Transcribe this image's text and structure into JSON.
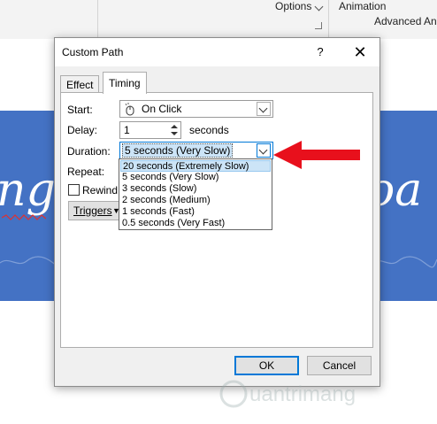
{
  "ribbon": {
    "options_label": "Options",
    "animation_label": "Animation",
    "advanced_label": "Advanced Anima"
  },
  "slide": {
    "left_script_text": "ng",
    "right_script_text": "oa"
  },
  "dialog": {
    "title": "Custom Path",
    "help_symbol": "?",
    "close_symbol": "✕",
    "tabs": [
      {
        "label": "Effect",
        "selected": false
      },
      {
        "label": "Timing",
        "selected": true
      }
    ],
    "start": {
      "label": "Start:",
      "value": "On Click"
    },
    "delay": {
      "label": "Delay:",
      "value": "1",
      "unit": "seconds"
    },
    "duration": {
      "label": "Duration:",
      "value": "5 seconds (Very Slow)"
    },
    "repeat": {
      "label": "Repeat:"
    },
    "rewind": {
      "label": "Rewind",
      "checked": false
    },
    "triggers": {
      "label": "Triggers"
    },
    "duration_options": [
      "20 seconds (Extremely Slow)",
      "5 seconds (Very Slow)",
      "3 seconds (Slow)",
      "2 seconds (Medium)",
      "1 seconds (Fast)",
      "0.5 seconds (Very Fast)"
    ],
    "highlighted_option_index": 0,
    "ok_label": "OK",
    "cancel_label": "Cancel"
  },
  "watermark": {
    "text": "uantrimang"
  },
  "colors": {
    "banner": "#4472c4",
    "arrow": "#e8101c",
    "selection": "#cce4f7",
    "focus": "#0078d7"
  }
}
